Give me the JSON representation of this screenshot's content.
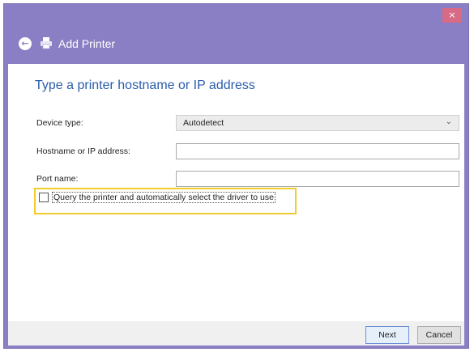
{
  "window": {
    "title": "Add Printer",
    "close_glyph": "×"
  },
  "nav": {
    "back_glyph": "←"
  },
  "heading": "Type a printer hostname or IP address",
  "form": {
    "device_type": {
      "label": "Device type:",
      "value": "Autodetect",
      "chevron": "⌄"
    },
    "hostname": {
      "label": "Hostname or IP address:",
      "value": ""
    },
    "port_name": {
      "label": "Port name:",
      "value": ""
    },
    "query_checkbox": {
      "label": "Query the printer and automatically select the driver to use",
      "checked": false
    }
  },
  "buttons": {
    "next": "Next",
    "cancel": "Cancel"
  },
  "colors": {
    "titlebar": "#8a7ec4",
    "heading": "#2a5dab",
    "highlight": "#f2cc2c",
    "close": "#d76b86"
  },
  "icons": [
    "back-arrow-icon",
    "printer-icon",
    "close-icon",
    "chevron-down-icon"
  ]
}
